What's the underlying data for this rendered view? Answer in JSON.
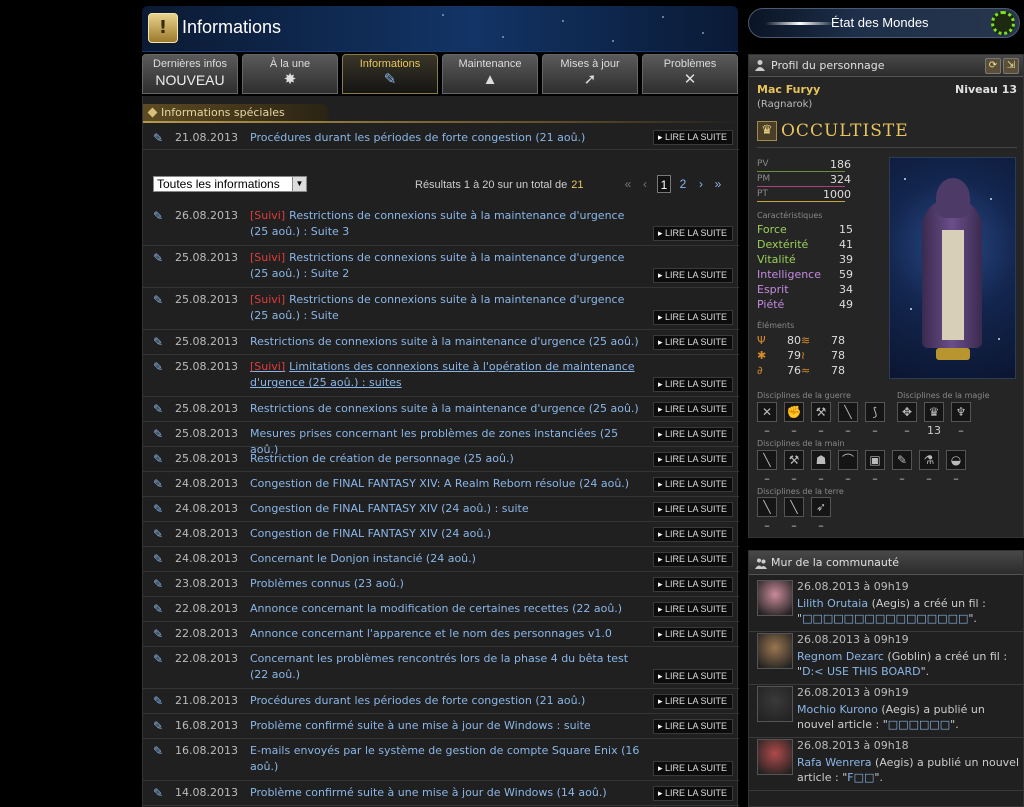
{
  "header": {
    "title": "Informations",
    "world_status_label": "État des Mondes"
  },
  "tabs": [
    {
      "label": "Dernières infos",
      "sub": "NOUVEAU",
      "icon": "new-badge",
      "active": false
    },
    {
      "label": "À la une",
      "sub": "✸",
      "icon": "sun-icon",
      "active": false
    },
    {
      "label": "Informations",
      "sub": "✎",
      "icon": "quill-icon",
      "active": true
    },
    {
      "label": "Maintenance",
      "sub": "▲",
      "icon": "warning-icon",
      "active": false
    },
    {
      "label": "Mises à jour",
      "sub": "➚",
      "icon": "arrow-up-right-icon",
      "active": false
    },
    {
      "label": "Problèmes",
      "sub": "✕",
      "icon": "x-icon",
      "active": false
    }
  ],
  "special": {
    "heading": "Informations spéciales",
    "item": {
      "date": "21.08.2013",
      "title": "Procédures durant les périodes de forte congestion (21 aoû.)",
      "more": "LIRE LA SUITE"
    }
  },
  "filter": {
    "select_value": "Toutes les informations",
    "results_text": "Résultats 1 à 20 sur un total de",
    "total": "21",
    "pages": [
      "1",
      "2"
    ],
    "current_page": "1"
  },
  "news": [
    {
      "date": "26.08.2013",
      "tag": "[Suivi]",
      "title": "Restrictions de connexions suite à la maintenance d'urgence (25 aoû.) : Suite 3",
      "more": "LIRE LA SUITE"
    },
    {
      "date": "25.08.2013",
      "tag": "[Suivi]",
      "title": "Restrictions de connexions suite à la maintenance d'urgence (25 aoû.) : Suite 2",
      "more": "LIRE LA SUITE"
    },
    {
      "date": "25.08.2013",
      "tag": "[Suivi]",
      "title": "Restrictions de connexions suite à la maintenance d'urgence (25 aoû.) : Suite",
      "more": "LIRE LA SUITE"
    },
    {
      "date": "25.08.2013",
      "tag": "",
      "title": "Restrictions de connexions suite à la maintenance d'urgence (25 aoû.)",
      "more": "LIRE LA SUITE"
    },
    {
      "date": "25.08.2013",
      "tag": "[Suivi]",
      "title": "Limitations des connexions suite à l'opération de maintenance d'urgence (25 aoû.) : suites",
      "more": "LIRE LA SUITE"
    },
    {
      "date": "25.08.2013",
      "tag": "",
      "title": "Restrictions de connexions suite à la maintenance d'urgence (25 aoû.)",
      "more": "LIRE LA SUITE"
    },
    {
      "date": "25.08.2013",
      "tag": "",
      "title": "Mesures prises concernant les problèmes de zones instanciées (25 aoû.)",
      "more": "LIRE LA SUITE"
    },
    {
      "date": "25.08.2013",
      "tag": "",
      "title": "Restriction de création de personnage (25 aoû.)",
      "more": "LIRE LA SUITE"
    },
    {
      "date": "24.08.2013",
      "tag": "",
      "title": "Congestion de FINAL FANTASY XIV: A Realm Reborn résolue (24 aoû.)",
      "more": "LIRE LA SUITE"
    },
    {
      "date": "24.08.2013",
      "tag": "",
      "title": "Congestion de FINAL FANTASY XIV (24 aoû.) : suite",
      "more": "LIRE LA SUITE"
    },
    {
      "date": "24.08.2013",
      "tag": "",
      "title": "Congestion de FINAL FANTASY XIV (24 aoû.)",
      "more": "LIRE LA SUITE"
    },
    {
      "date": "24.08.2013",
      "tag": "",
      "title": "Concernant le Donjon instancié (24 aoû.)",
      "more": "LIRE LA SUITE"
    },
    {
      "date": "23.08.2013",
      "tag": "",
      "title": "Problèmes connus (23 aoû.)",
      "more": "LIRE LA SUITE"
    },
    {
      "date": "22.08.2013",
      "tag": "",
      "title": "Annonce concernant la modification de certaines recettes (22 aoû.)",
      "more": "LIRE LA SUITE"
    },
    {
      "date": "22.08.2013",
      "tag": "",
      "title": "Annonce concernant l'apparence et le nom des personnages v1.0",
      "more": "LIRE LA SUITE"
    },
    {
      "date": "22.08.2013",
      "tag": "",
      "title": "Concernant les problèmes rencontrés lors de la phase 4 du bêta test (22 aoû.)",
      "more": "LIRE LA SUITE"
    },
    {
      "date": "21.08.2013",
      "tag": "",
      "title": "Procédures durant les périodes de forte congestion (21 aoû.)",
      "more": "LIRE LA SUITE"
    },
    {
      "date": "16.08.2013",
      "tag": "",
      "title": "Problème confirmé suite à une mise à jour de Windows : suite",
      "more": "LIRE LA SUITE"
    },
    {
      "date": "16.08.2013",
      "tag": "",
      "title": "E-mails envoyés par le système de gestion de compte Square Enix (16 aoû.)",
      "more": "LIRE LA SUITE"
    },
    {
      "date": "14.08.2013",
      "tag": "",
      "title": "Problème confirmé suite à une mise à jour de Windows (14 aoû.)",
      "more": "LIRE LA SUITE"
    }
  ],
  "profile": {
    "heading": "Profil du personnage",
    "name": "Mac Furyy",
    "world": "(Ragnarok)",
    "level": "Niveau 13",
    "job": "OCCULTISTE",
    "vitals": [
      {
        "label": "PV",
        "value": "186",
        "color": "#6a8f3a"
      },
      {
        "label": "PM",
        "value": "324",
        "color": "#b0407a"
      },
      {
        "label": "PT",
        "value": "1000",
        "color": "#c7a53a"
      }
    ],
    "attributes_label": "Caractéristiques",
    "attributes": [
      {
        "label": "Force",
        "value": "15",
        "color": "#9ad05a"
      },
      {
        "label": "Dextérité",
        "value": "41",
        "color": "#9ad05a"
      },
      {
        "label": "Vitalité",
        "value": "39",
        "color": "#9ad05a"
      },
      {
        "label": "Intelligence",
        "value": "59",
        "color": "#c58ae0"
      },
      {
        "label": "Esprit",
        "value": "34",
        "color": "#c58ae0"
      },
      {
        "label": "Piété",
        "value": "49",
        "color": "#c58ae0"
      }
    ],
    "elements_label": "Éléments",
    "elements": [
      {
        "icon": "fire-icon",
        "glyph": "Ψ",
        "value": "80"
      },
      {
        "icon": "wind-icon",
        "glyph": "≋",
        "value": "78"
      },
      {
        "icon": "ice-icon",
        "glyph": "✱",
        "value": "79"
      },
      {
        "icon": "lightning-icon",
        "glyph": "≀",
        "value": "78"
      },
      {
        "icon": "earth-icon",
        "glyph": "∂",
        "value": "76"
      },
      {
        "icon": "water-icon",
        "glyph": "≈",
        "value": "78"
      }
    ],
    "war_label": "Disciplines de la guerre",
    "magic_label": "Disciplines de la magie",
    "hand_label": "Disciplines de la main",
    "land_label": "Disciplines de la terre",
    "war": [
      {
        "icon": "gladiator-icon",
        "glyph": "✕",
        "level": "–"
      },
      {
        "icon": "pugilist-icon",
        "glyph": "✊",
        "level": "–"
      },
      {
        "icon": "marauder-icon",
        "glyph": "⚒",
        "level": "–"
      },
      {
        "icon": "lancer-icon",
        "glyph": "╲",
        "level": "–"
      },
      {
        "icon": "archer-icon",
        "glyph": "⟆",
        "level": "–"
      }
    ],
    "magic": [
      {
        "icon": "conjurer-icon",
        "glyph": "✥",
        "level": "–"
      },
      {
        "icon": "arcanist-icon",
        "glyph": "♛",
        "level": "13"
      },
      {
        "icon": "thaumaturge-icon",
        "glyph": "♆",
        "level": "–"
      }
    ],
    "hand": [
      {
        "icon": "carpenter-icon",
        "glyph": "╲",
        "level": "–"
      },
      {
        "icon": "blacksmith-icon",
        "glyph": "⚒",
        "level": "–"
      },
      {
        "icon": "armorer-icon",
        "glyph": "☗",
        "level": "–"
      },
      {
        "icon": "goldsmith-icon",
        "glyph": "⌒",
        "level": "–"
      },
      {
        "icon": "leatherworker-icon",
        "glyph": "▣",
        "level": "–"
      },
      {
        "icon": "weaver-icon",
        "glyph": "✎",
        "level": "–"
      },
      {
        "icon": "alchemist-icon",
        "glyph": "⚗",
        "level": "–"
      },
      {
        "icon": "culinarian-icon",
        "glyph": "◒",
        "level": "–"
      }
    ],
    "land": [
      {
        "icon": "miner-icon",
        "glyph": "╲",
        "level": "–"
      },
      {
        "icon": "botanist-icon",
        "glyph": "╲",
        "level": "–"
      },
      {
        "icon": "fisher-icon",
        "glyph": "➶",
        "level": "–"
      }
    ]
  },
  "community": {
    "heading": "Mur de la communauté",
    "posts": [
      {
        "time": "26.08.2013 à 09h19",
        "name": "Lilith Orutaia",
        "world": "(Aegis)",
        "action": "a créé un fil : \"",
        "link": "□□□□□□□□□□□□□□□□",
        "end": "\".",
        "avatar_bg": "#c98a9a"
      },
      {
        "time": "26.08.2013 à 09h19",
        "name": "Regnom Dezarc",
        "world": "(Goblin)",
        "action": "a créé un fil : \"",
        "link": "D:< USE THIS BOARD",
        "end": "\".",
        "avatar_bg": "#9a7650"
      },
      {
        "time": "26.08.2013 à 09h19",
        "name": "Mochio Kurono",
        "world": "(Aegis)",
        "action": "a publié un nouvel article : \"",
        "link": "□□□□□□",
        "end": "\".",
        "avatar_bg": "#3a3a3a"
      },
      {
        "time": "26.08.2013 à 09h18",
        "name": "Rafa Wenrera",
        "world": "(Aegis)",
        "action": "a publié un nouvel article : \"",
        "link": "F□□",
        "end": "\".",
        "avatar_bg": "#b04a4a"
      }
    ]
  }
}
